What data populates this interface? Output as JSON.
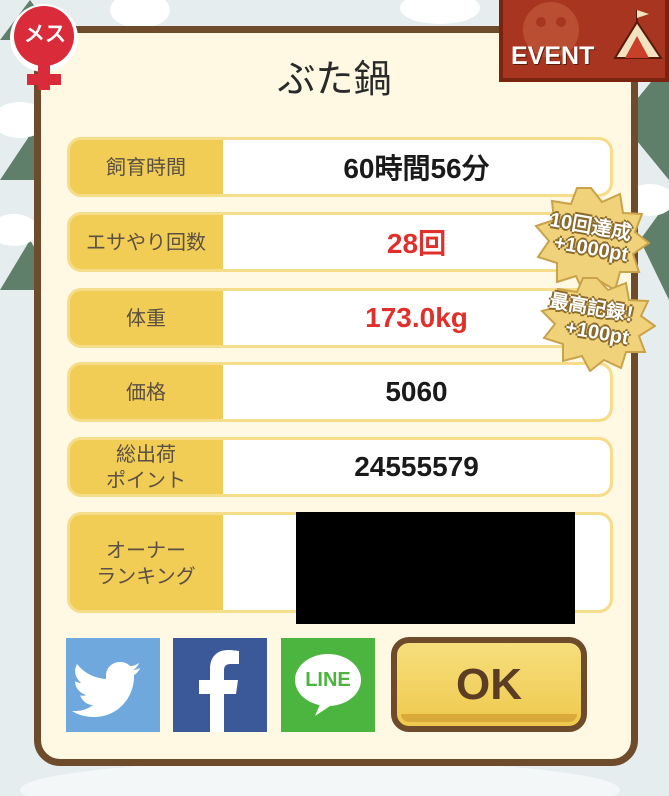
{
  "gender_badge": {
    "label": "メス",
    "icon": "female-symbol-icon",
    "color": "#d92b3a"
  },
  "event_badge": {
    "label": "EVENT",
    "icon": "circus-tent-icon"
  },
  "pig_name": "ぶた鍋",
  "stats": [
    {
      "label": "飼育時間",
      "value": "60時間56分",
      "highlight": false
    },
    {
      "label": "エサやり回数",
      "value": "28回",
      "highlight": true
    },
    {
      "label": "体重",
      "value": "173.0kg",
      "highlight": true
    },
    {
      "label": "価格",
      "value": "5060",
      "highlight": false
    },
    {
      "label": "総出荷\nポイント",
      "value": "24555579",
      "highlight": false
    },
    {
      "label": "オーナー\nランキング",
      "value": "",
      "highlight": false
    }
  ],
  "achievements": [
    {
      "line1": "10回達成",
      "line2": "+1000pt"
    },
    {
      "line1": "最高記録！",
      "line2": "+100pt"
    }
  ],
  "share": {
    "twitter": {
      "icon": "twitter-bird-icon",
      "color": "#6fa8dc"
    },
    "facebook": {
      "icon": "facebook-f-icon",
      "color": "#3b5998"
    },
    "line": {
      "label": "LINE",
      "icon": "line-bubble-icon",
      "color": "#4cb540"
    }
  },
  "ok_label": "OK",
  "colors": {
    "panel_border": "#6e4b2a",
    "panel_bg": "#fff9e4",
    "label_bg": "#f1cd55",
    "highlight_text": "#e0302b"
  }
}
